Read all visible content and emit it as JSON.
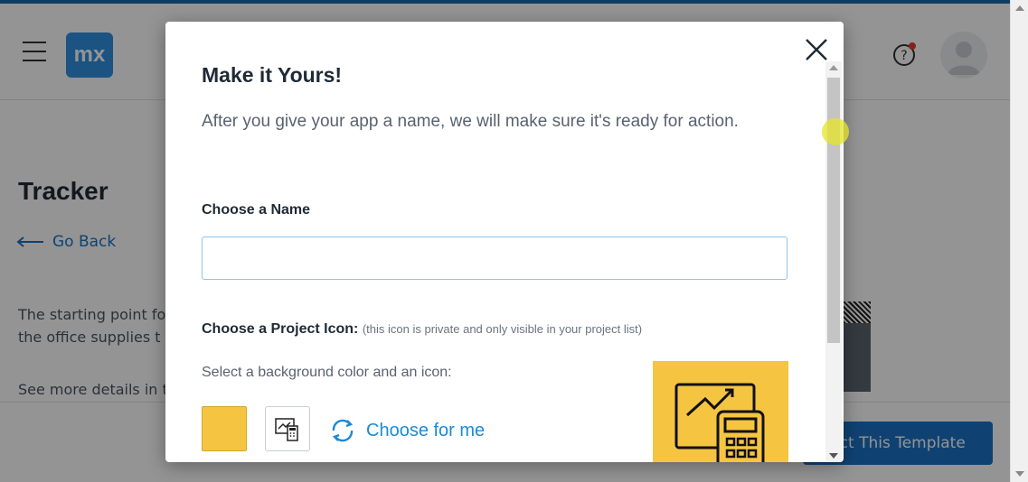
{
  "header": {
    "logo_text": "mx",
    "help_icon": "help-icon",
    "help_notification_color": "#e53935"
  },
  "page": {
    "title": "Tracker",
    "go_back": "Go Back",
    "description_line1": "The starting point fo",
    "description_line2": "the office supplies t",
    "more_details": "See more details in t",
    "select_template_label": "ect This Template"
  },
  "modal": {
    "title": "Make it Yours!",
    "intro": "After you give your app a name, we will make sure it's ready for action.",
    "name_label": "Choose a Name",
    "name_value": "",
    "name_placeholder": "",
    "icon_label": "Choose a Project Icon:",
    "icon_note": "(this icon is private and only visible in your project list)",
    "select_instructions": "Select a background color and an icon:",
    "choose_for_me": "Choose for me",
    "selected_color": "#f5c542",
    "selected_icon": "chart-calculator-icon"
  },
  "colors": {
    "accent": "#1b73c7",
    "link": "#1b8ad8",
    "logo": "#2f8fe0"
  }
}
